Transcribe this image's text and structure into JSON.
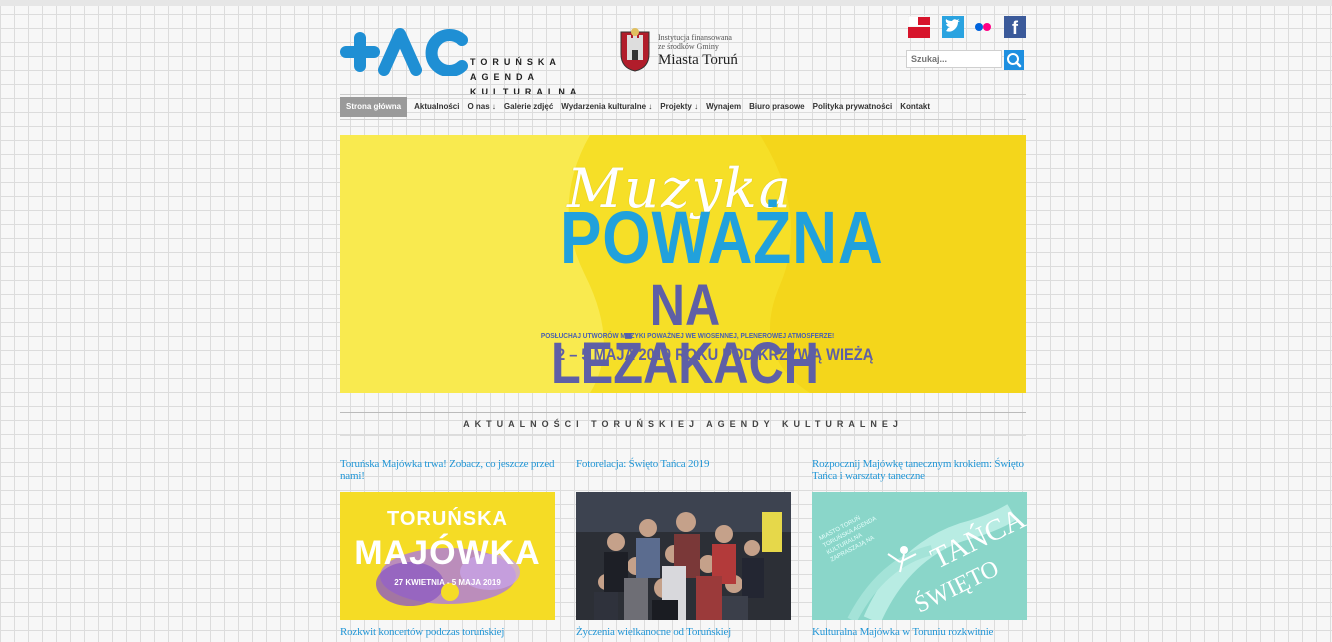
{
  "brand": {
    "logo_lines": [
      "TORUŃSKA",
      "AGENDA",
      "KULTURALNA"
    ],
    "accent": "#1f8fd4"
  },
  "institution": {
    "line1": "Instytucja finansowana",
    "line2": "ze środków Gminy",
    "line3": "Miasta Toruń"
  },
  "social": {
    "bip_label": "bip",
    "facebook_label": "f"
  },
  "search": {
    "placeholder": "Szukaj..."
  },
  "nav": {
    "items": [
      {
        "label": "Strona główna",
        "active": true
      },
      {
        "label": "Aktualności"
      },
      {
        "label": "O nas ↓"
      },
      {
        "label": "Galerie zdjęć"
      },
      {
        "label": "Wydarzenia kulturalne ↓"
      },
      {
        "label": "Projekty ↓"
      },
      {
        "label": "Wynajem"
      },
      {
        "label": "Biuro prasowe"
      },
      {
        "label": "Polityka prywatności"
      },
      {
        "label": "Kontakt"
      }
    ]
  },
  "banner": {
    "script": "Muzyka",
    "title1": "POWAŻNA",
    "title2": "NA LEŻAKACH",
    "subtitle": "POSŁUCHAJ UTWORÓW MUZYKI POWAŻNEJ WE WIOSENNEJ, PLENEROWEJ ATMOSFERZE!",
    "dates": "2 – 5 MAJA 2019 ROKU   POD KRZYWĄ WIEŻĄ"
  },
  "section": {
    "title": "AKTUALNOŚCI TORUŃSKIEJ AGENDY KULTURALNEJ"
  },
  "news": [
    {
      "title": "Toruńska Majówka trwa! Zobacz, co jeszcze przed nami!",
      "img_line1": "TORUŃSKA",
      "img_line2": "MAJÓWKA",
      "img_line3": "27 KWIETNIA - 5 MAJA 2019"
    },
    {
      "title": "Fotorelacja: Święto Tańca 2019"
    },
    {
      "title": "Rozpocznij Majówkę tanecznym krokiem: Święto Tańca i warsztaty taneczne",
      "img_small": "MIASTO TORUŃ\nTORUŃSKA AGENDA\nKULTURALNA\nZAPRASZAJĄ NA",
      "img_title": "TAŃCA",
      "img_swieto": "ŚWIĘTO"
    }
  ],
  "news_row2": [
    "Rozkwit koncertów podczas toruńskiej",
    "Życzenia wielkanocne od Toruńskiej",
    "Kulturalna Majówka w Toruniu rozkwitnie"
  ]
}
